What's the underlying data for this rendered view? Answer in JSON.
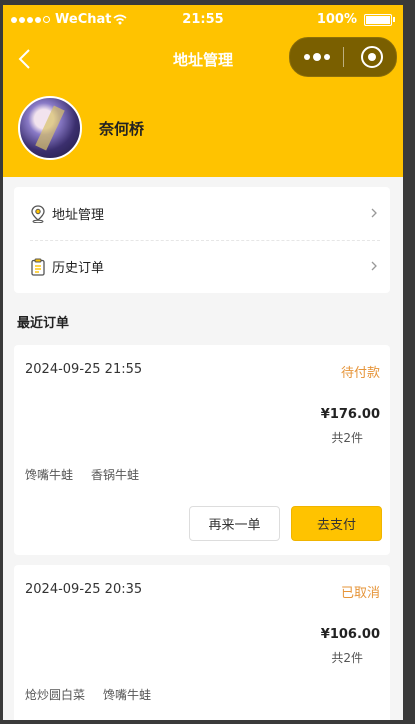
{
  "status_bar": {
    "carrier": "WeChat",
    "time": "21:55",
    "battery": "100%"
  },
  "nav": {
    "title": "地址管理"
  },
  "profile": {
    "name": "奈何桥"
  },
  "menu": {
    "items": [
      {
        "label": "地址管理",
        "icon": "location-pin-icon"
      },
      {
        "label": "历史订单",
        "icon": "clipboard-icon"
      }
    ]
  },
  "recent": {
    "title": "最近订单",
    "orders": [
      {
        "time": "2024-09-25 21:55",
        "status": "待付款",
        "price": "¥176.00",
        "count": "共2件",
        "items": [
          "馋嘴牛蛙",
          "香锅牛蛙"
        ],
        "reorder_label": "再来一单",
        "pay_label": "去支付"
      },
      {
        "time": "2024-09-25 20:35",
        "status": "已取消",
        "price": "¥106.00",
        "count": "共2件",
        "items": [
          "炝炒圆白菜",
          "馋嘴牛蛙"
        ]
      }
    ]
  },
  "colors": {
    "accent": "#ffc300",
    "status_text": "#e6953a",
    "page_bg": "#f5f5f5"
  }
}
